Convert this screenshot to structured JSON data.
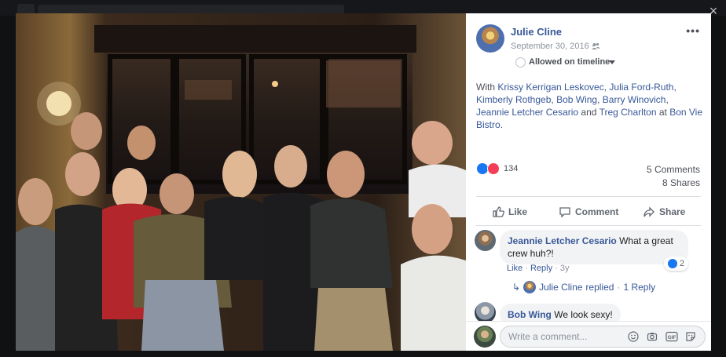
{
  "window": {
    "close_label": "×"
  },
  "post": {
    "author": "Julie Cline",
    "date": "September 30, 2016",
    "date_separator": "·",
    "audience_icon": "friends-icon",
    "more_label": "•••",
    "timeline_label": "Allowed on timeline",
    "tag_prefix": "With",
    "tags": [
      "Krissy Kerrigan Leskovec",
      "Julia Ford-Ruth",
      "Kimberly Rothgeb",
      "Bob Wing",
      "Barry Winovich",
      "Jeannie Letcher Cesario",
      "Treg Charlton"
    ],
    "tag_sep": ",",
    "tag_and": "and",
    "tag_at": "at",
    "location": "Bon Vie Bistro",
    "tag_end": "."
  },
  "stats": {
    "reactions_count": "134",
    "comments": "5 Comments",
    "shares": "8 Shares"
  },
  "actions": {
    "like": "Like",
    "comment": "Comment",
    "share": "Share"
  },
  "comments": [
    {
      "author": "Jeannie Letcher Cesario",
      "text_line1": "What a great",
      "text_line2": "crew huh?!",
      "like_label": "Like",
      "reply_label": "Reply",
      "time": "3y",
      "reaction_count": "2",
      "replies": {
        "author": "Julie Cline",
        "verb": "replied",
        "count": "1 Reply"
      }
    },
    {
      "author": "Bob Wing",
      "text": "We look sexy!"
    }
  ],
  "composer": {
    "placeholder": "Write a comment...",
    "icons": [
      "emoji-icon",
      "camera-icon",
      "gif-icon",
      "sticker-icon"
    ],
    "gif_label": "GIF"
  },
  "colors": {
    "link_blue": "#385898",
    "like_blue": "#1877f2",
    "love_red": "#f33e58"
  }
}
